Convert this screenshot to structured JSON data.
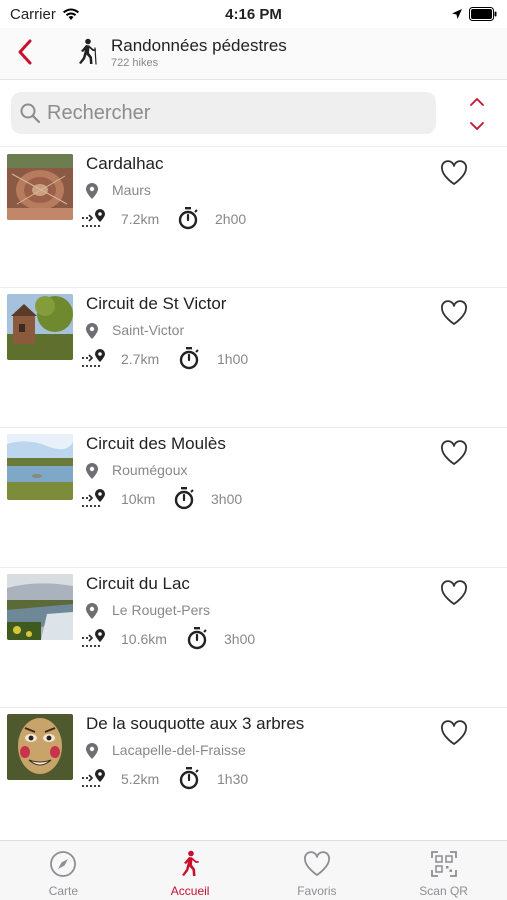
{
  "status_bar": {
    "carrier": "Carrier",
    "time": "4:16 PM"
  },
  "header": {
    "title": "Randonnées pédestres",
    "subtitle": "722 hikes"
  },
  "search": {
    "placeholder": "Rechercher",
    "value": ""
  },
  "colors": {
    "accent": "#c8102e",
    "secondary_text": "#888888",
    "icon_gray": "#6e6e73"
  },
  "hikes": [
    {
      "name": "Cardalhac",
      "town": "Maurs",
      "distance": "7.2km",
      "duration": "2h00"
    },
    {
      "name": "Circuit de St Victor",
      "town": "Saint-Victor",
      "distance": "2.7km",
      "duration": "1h00"
    },
    {
      "name": "Circuit des Moulès",
      "town": "Roumégoux",
      "distance": "10km",
      "duration": "3h00"
    },
    {
      "name": "Circuit du Lac",
      "town": "Le Rouget-Pers",
      "distance": "10.6km",
      "duration": "3h00"
    },
    {
      "name": "De la souquotte aux 3 arbres",
      "town": "Lacapelle-del-Fraisse",
      "distance": "5.2km",
      "duration": "1h30"
    }
  ],
  "tabs": [
    {
      "label": "Carte",
      "icon": "compass-icon",
      "active": false
    },
    {
      "label": "Accueil",
      "icon": "hiker-icon",
      "active": true
    },
    {
      "label": "Favoris",
      "icon": "heart-icon",
      "active": false
    },
    {
      "label": "Scan QR",
      "icon": "qr-code-icon",
      "active": false
    }
  ]
}
